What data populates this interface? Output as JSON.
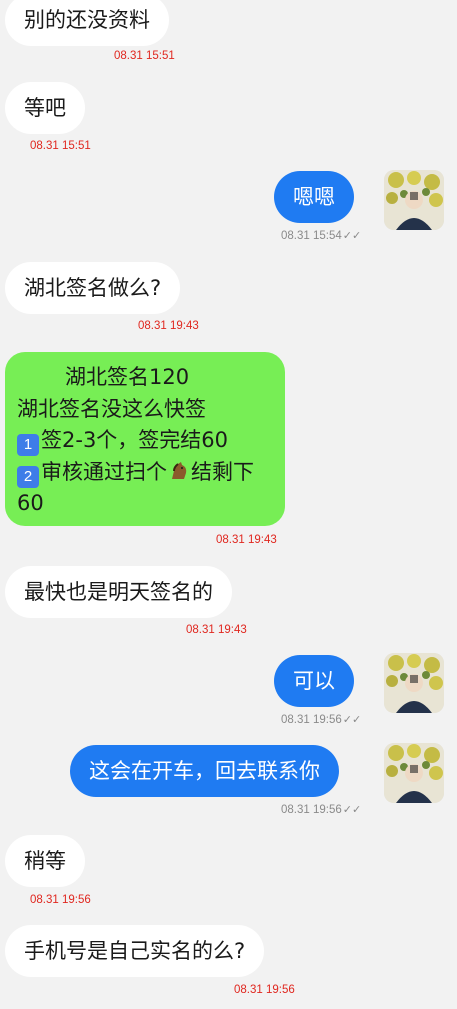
{
  "messages": [
    {
      "side": "in",
      "text": "别的还没资料",
      "time": "08.31 15:51"
    },
    {
      "side": "in",
      "text": "等吧",
      "time": "08.31 15:51"
    },
    {
      "side": "out",
      "text": "嗯嗯",
      "time": "08.31 15:54"
    },
    {
      "side": "in",
      "text": "湖北签名做么?",
      "time": "08.31 19:43"
    },
    {
      "side": "in-green",
      "lines": [
        "湖北签名120",
        "湖北签名没这么快签",
        "签2-3个，签完结60",
        "审核通过扫个",
        "结剩下",
        "60"
      ],
      "keycaps": [
        "1",
        "2"
      ],
      "emoji": "horse-icon",
      "time": "08.31 19:43"
    },
    {
      "side": "in",
      "text": "最快也是明天签名的",
      "time": "08.31 19:43"
    },
    {
      "side": "out",
      "text": "可以",
      "time": "08.31 19:56"
    },
    {
      "side": "out",
      "text": "这会在开车，回去联系你",
      "time": "08.31 19:56"
    },
    {
      "side": "in",
      "text": "稍等",
      "time": "08.31 19:56"
    },
    {
      "side": "in",
      "text": "手机号是自己实名的么?",
      "time": "08.31 19:56"
    }
  ],
  "read_ticks": "✓✓",
  "colors": {
    "background": "#f2f2f2",
    "incoming_bubble": "#ffffff",
    "green_bubble": "#77ee55",
    "outgoing_bubble": "#1f7bf2",
    "incoming_time": "#e0271f",
    "outgoing_time": "#8a8a8a"
  }
}
